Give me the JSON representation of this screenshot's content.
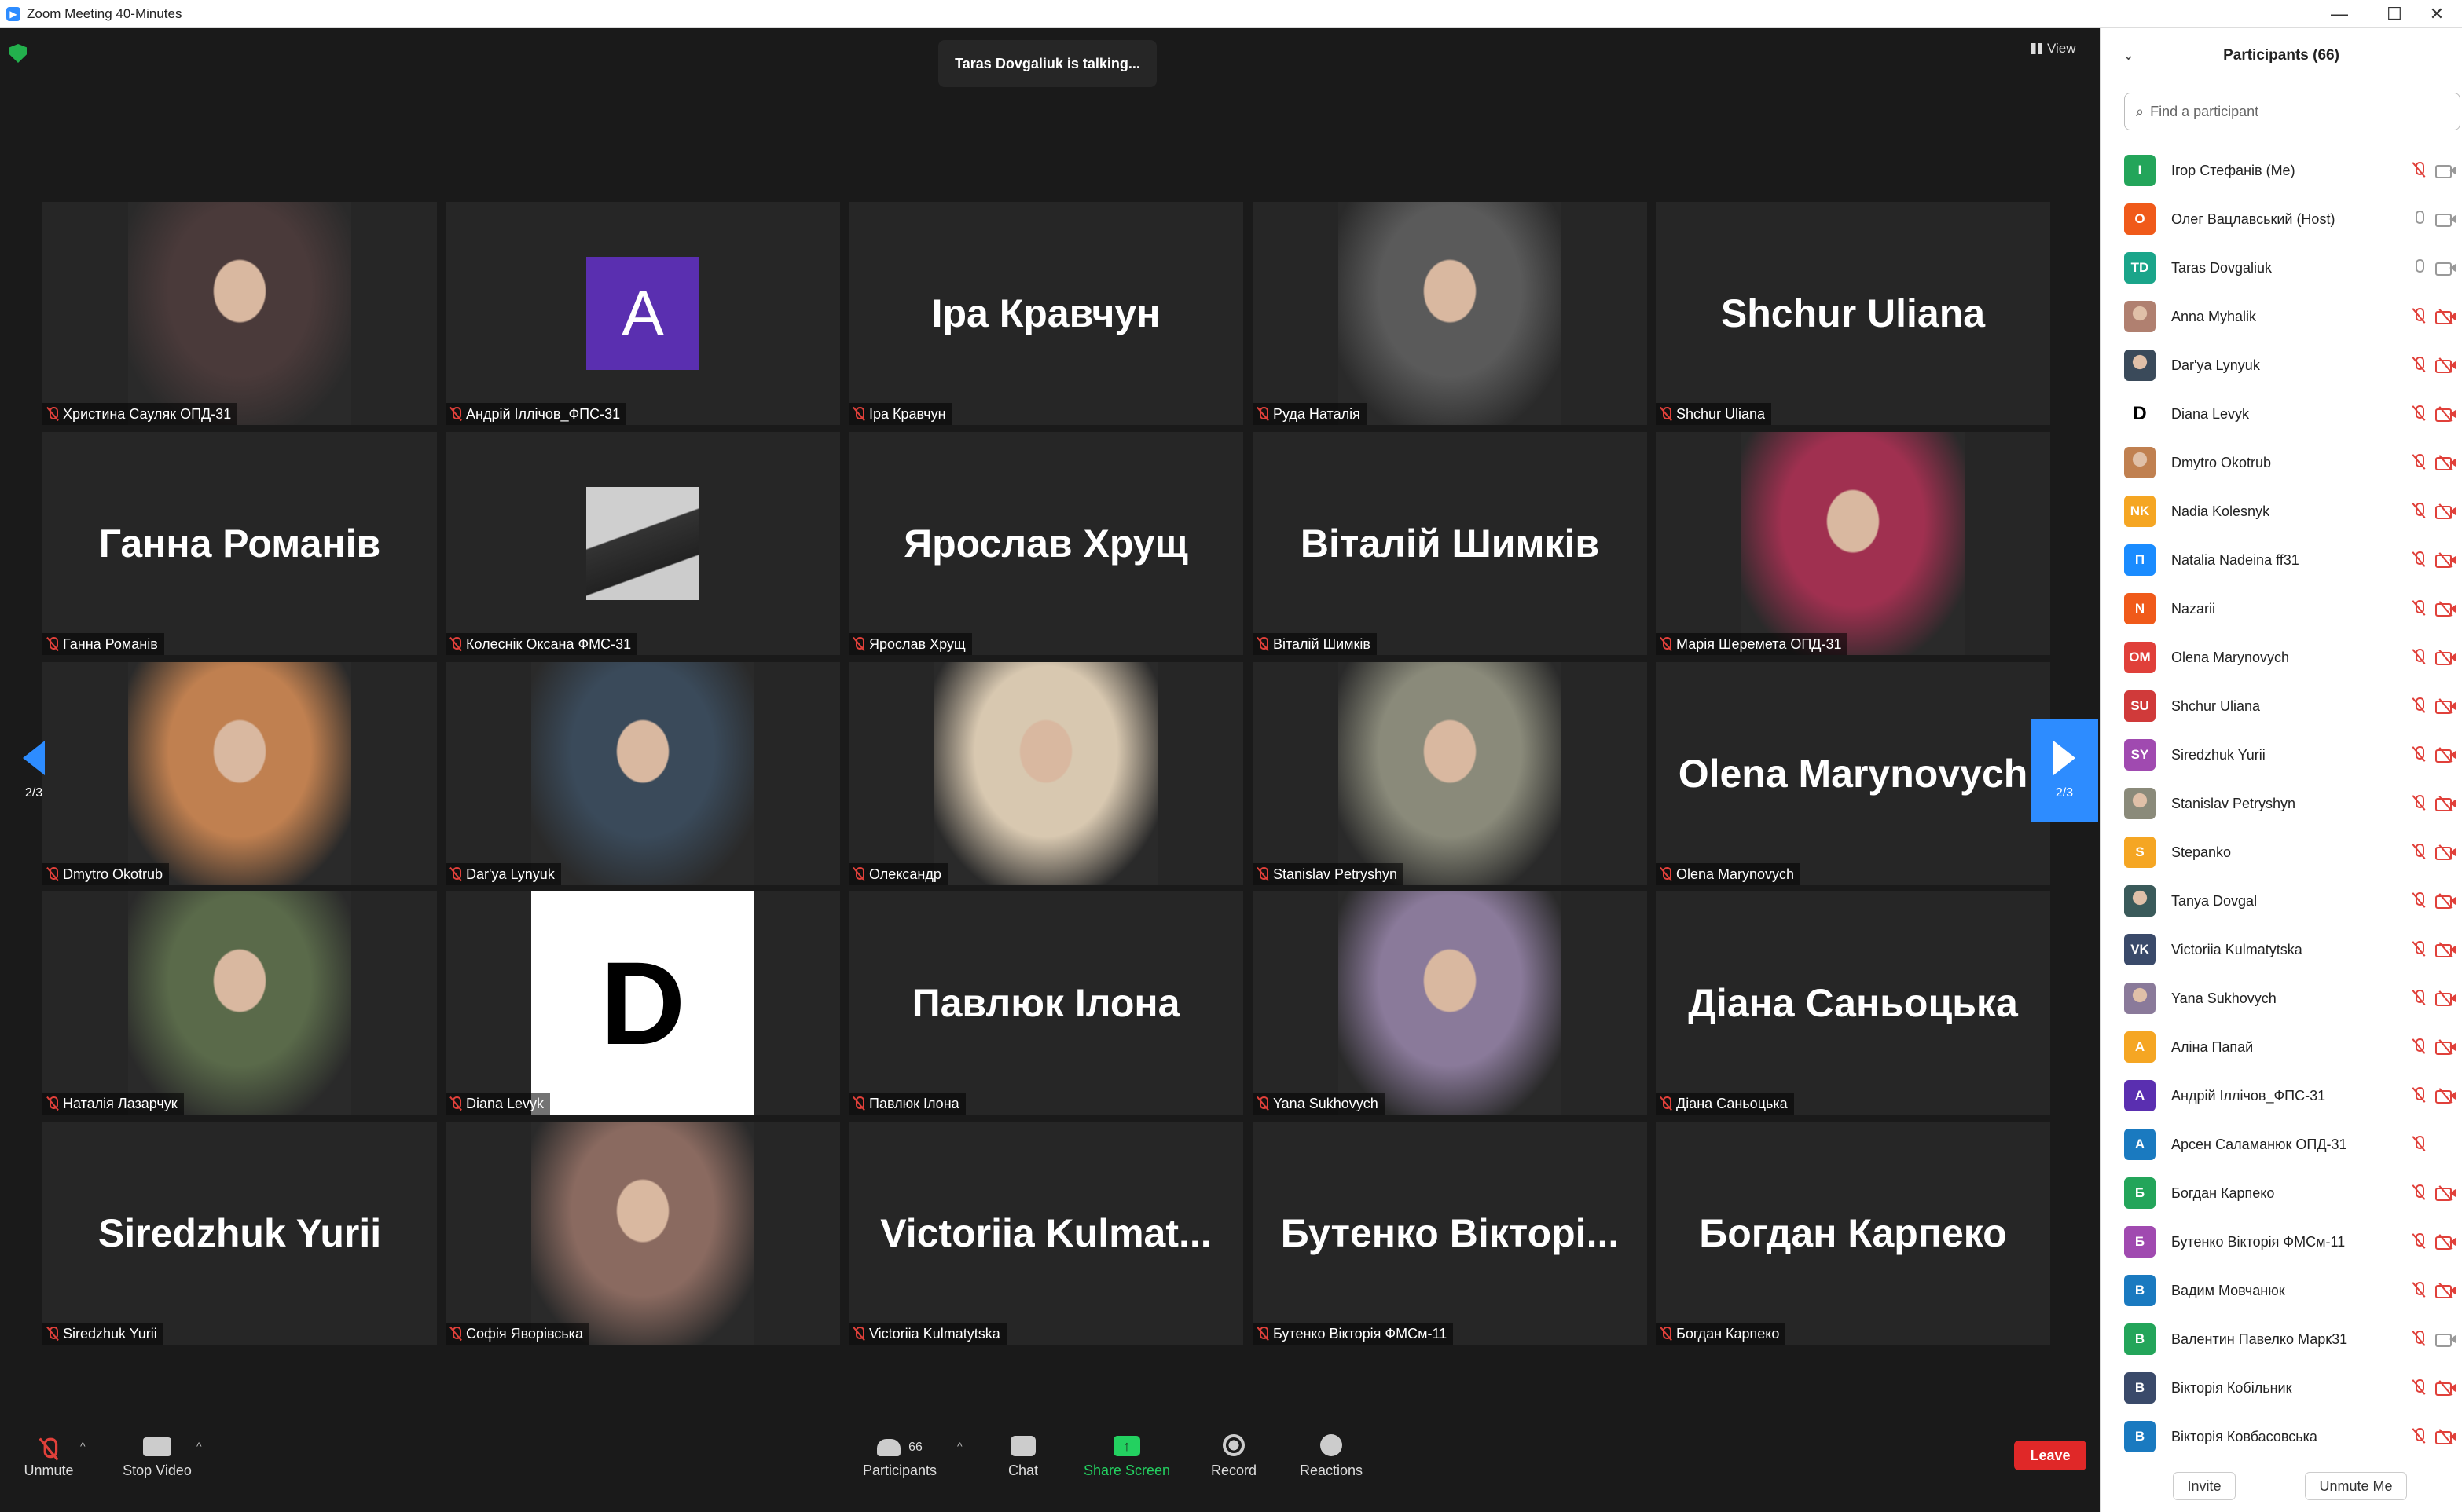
{
  "window": {
    "title": "Zoom Meeting 40-Minutes",
    "minimize": "—",
    "maximize": "☐",
    "close": "✕"
  },
  "meeting": {
    "talking": "Taras Dovgaliuk is talking...",
    "view_label": "View",
    "page_indicator": "2/3"
  },
  "tiles": [
    {
      "label": "Христина Сауляк ОПД-31",
      "kind": "photo",
      "color": "#4a3a3a"
    },
    {
      "label": "Андрій Іллічов_ФПС-31",
      "kind": "avatar",
      "letter": "A",
      "color": "#5a2fb0"
    },
    {
      "label": "Іра Кравчун",
      "kind": "text",
      "text": "Іра Кравчун"
    },
    {
      "label": "Руда Наталія",
      "kind": "photo",
      "color": "#5a5a5a"
    },
    {
      "label": "Shchur Uliana",
      "kind": "text",
      "text": "Shchur Uliana"
    },
    {
      "label": "Ганна Романів",
      "kind": "text",
      "text": "Ганна Романів"
    },
    {
      "label": "Колеснік Оксана ФМС-31",
      "kind": "smallphoto",
      "color": "#cfcfcf"
    },
    {
      "label": "Ярослав Хрущ",
      "kind": "text",
      "text": "Ярослав Хрущ"
    },
    {
      "label": "Віталій Шимків",
      "kind": "text",
      "text": "Віталій Шимків"
    },
    {
      "label": "Марія Шеремета ОПД-31",
      "kind": "photo",
      "color": "#a03050"
    },
    {
      "label": "Dmytro Okotrub",
      "kind": "photo",
      "color": "#c08050"
    },
    {
      "label": "Dar'ya Lynyuk",
      "kind": "photo",
      "color": "#3a4a5a"
    },
    {
      "label": "Олександр",
      "kind": "photo",
      "color": "#d8c8b0"
    },
    {
      "label": "Stanislav Petryshyn",
      "kind": "photo",
      "color": "#8a8a7a"
    },
    {
      "label": "Olena Marynovych",
      "kind": "text",
      "text": "Olena Marynovych"
    },
    {
      "label": "Наталія Лазарчук",
      "kind": "photo",
      "color": "#5a6a4a"
    },
    {
      "label": "Diana Levyk",
      "kind": "bigletter",
      "letter": "D",
      "color": "#ffffff"
    },
    {
      "label": "Павлюк Ілона",
      "kind": "text",
      "text": "Павлюк Ілона"
    },
    {
      "label": "Yana Sukhovych",
      "kind": "photo",
      "color": "#8a7a9a"
    },
    {
      "label": "Діана Саньоцька",
      "kind": "text",
      "text": "Діана Саньоцька"
    },
    {
      "label": "Siredzhuk Yurii",
      "kind": "text",
      "text": "Siredzhuk Yurii"
    },
    {
      "label": "Софія Яворівська",
      "kind": "photo",
      "color": "#8a6a60"
    },
    {
      "label": "Victoriia Kulmatytska",
      "kind": "text",
      "text": "Victoriia  Kulmat..."
    },
    {
      "label": "Бутенко Вікторія ФМСм-11",
      "kind": "text",
      "text": "Бутенко  Вікторі..."
    },
    {
      "label": "Богдан Карпеко",
      "kind": "text",
      "text": "Богдан Карпеко"
    }
  ],
  "toolbar": {
    "unmute": "Unmute",
    "stop_video": "Stop Video",
    "participants": "Participants",
    "participants_count": "66",
    "chat": "Chat",
    "share_screen": "Share Screen",
    "record": "Record",
    "reactions": "Reactions",
    "leave": "Leave"
  },
  "panel": {
    "title": "Participants (66)",
    "search_placeholder": "Find a participant",
    "invite": "Invite",
    "unmute_me": "Unmute Me",
    "participants": [
      {
        "name": "Ігор Стефанів (Me)",
        "initials": "I",
        "color": "#23a55a",
        "mic": "off",
        "cam": "on"
      },
      {
        "name": "Олег Вацлавський (Host)",
        "initials": "О",
        "color": "#f05a1a",
        "mic": "on",
        "cam": "on"
      },
      {
        "name": "Taras Dovgaliuk",
        "initials": "TD",
        "color": "#1aa58a",
        "mic": "on",
        "cam": "on"
      },
      {
        "name": "Anna Myhalik",
        "initials": "",
        "color": "#b08070",
        "mic": "off",
        "cam": "off"
      },
      {
        "name": "Dar'ya Lynyuk",
        "initials": "",
        "color": "#3a4a5a",
        "mic": "off",
        "cam": "off"
      },
      {
        "name": "Diana Levyk",
        "initials": "D",
        "color": "#ffffff",
        "mic": "off",
        "cam": "off"
      },
      {
        "name": "Dmytro Okotrub",
        "initials": "",
        "color": "#c08050",
        "mic": "off",
        "cam": "off"
      },
      {
        "name": "Nadia Kolesnyk",
        "initials": "NK",
        "color": "#f5a623",
        "mic": "off",
        "cam": "off"
      },
      {
        "name": "Natalia Nadeina ff31",
        "initials": "П",
        "color": "#1a8cff",
        "mic": "off",
        "cam": "off"
      },
      {
        "name": "Nazarii",
        "initials": "N",
        "color": "#f05a1a",
        "mic": "off",
        "cam": "off"
      },
      {
        "name": "Olena Marynovych",
        "initials": "OM",
        "color": "#e0403a",
        "mic": "off",
        "cam": "off"
      },
      {
        "name": "Shchur Uliana",
        "initials": "SU",
        "color": "#d03a3a",
        "mic": "off",
        "cam": "off"
      },
      {
        "name": "Siredzhuk Yurii",
        "initials": "SY",
        "color": "#a04ab0",
        "mic": "off",
        "cam": "off"
      },
      {
        "name": "Stanislav Petryshyn",
        "initials": "",
        "color": "#8a8a7a",
        "mic": "off",
        "cam": "off"
      },
      {
        "name": "Stepanko",
        "initials": "S",
        "color": "#f5a623",
        "mic": "off",
        "cam": "off"
      },
      {
        "name": "Tanya Dovgal",
        "initials": "",
        "color": "#3a5a5a",
        "mic": "off",
        "cam": "off"
      },
      {
        "name": "Victoriia Kulmatytska",
        "initials": "VK",
        "color": "#3a4a6a",
        "mic": "off",
        "cam": "off"
      },
      {
        "name": "Yana Sukhovych",
        "initials": "",
        "color": "#8a7a9a",
        "mic": "off",
        "cam": "off"
      },
      {
        "name": "Аліна Папай",
        "initials": "А",
        "color": "#f5a623",
        "mic": "off",
        "cam": "off"
      },
      {
        "name": "Андрій Іллічов_ФПС-31",
        "initials": "A",
        "color": "#5a2fb0",
        "mic": "off",
        "cam": "off"
      },
      {
        "name": "Арсен Саламанюк ОПД-31",
        "initials": "А",
        "color": "#1a7ac0",
        "mic": "off",
        "cam": "none"
      },
      {
        "name": "Богдан Карпеко",
        "initials": "Б",
        "color": "#23a55a",
        "mic": "off",
        "cam": "off"
      },
      {
        "name": "Бутенко Вікторія ФМСм-11",
        "initials": "Б",
        "color": "#a04ab0",
        "mic": "off",
        "cam": "off"
      },
      {
        "name": "Вадим Мовчанюк",
        "initials": "В",
        "color": "#1a7ac0",
        "mic": "off",
        "cam": "off"
      },
      {
        "name": "Валентин Павелко Марк31",
        "initials": "В",
        "color": "#23a55a",
        "mic": "off",
        "cam": "on"
      },
      {
        "name": "Вікторія Кобільник",
        "initials": "В",
        "color": "#3a4a6a",
        "mic": "off",
        "cam": "off"
      },
      {
        "name": "Вікторія Ковбасовська",
        "initials": "В",
        "color": "#1a7ac0",
        "mic": "off",
        "cam": "off"
      }
    ]
  }
}
